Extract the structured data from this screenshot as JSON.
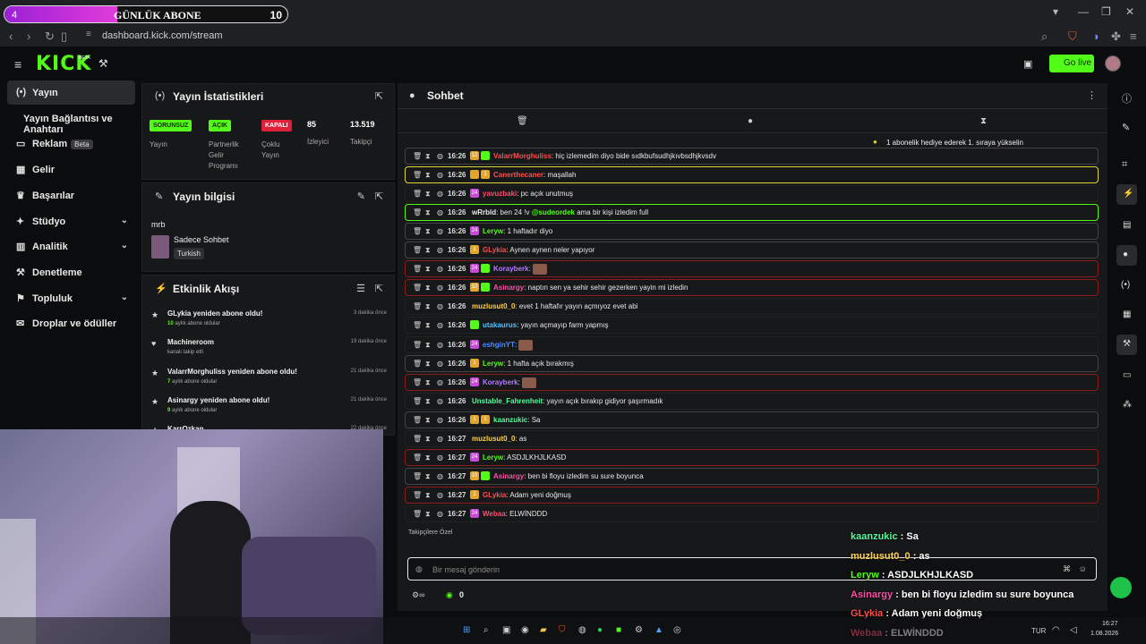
{
  "browser": {
    "url": "dashboard.kick.com/stream",
    "sub_progress_num": "4",
    "sub_label": "GÜNLÜK ABONE",
    "sub_count": "10",
    "sub_progress": 0.4
  },
  "header": {
    "logo": "KICK",
    "beta": "BETA",
    "go_live": "Go live"
  },
  "sidebar": [
    {
      "label": "Yayın",
      "icon": "stream-icon",
      "active": true
    },
    {
      "label": "Yayın Bağlantısı ve Anahtarı"
    },
    {
      "label": "Reklam",
      "badge": "Beta",
      "icon": "tv-icon"
    },
    {
      "label": "Gelir",
      "icon": "chart-icon"
    },
    {
      "label": "Başarılar",
      "icon": "trophy-icon"
    },
    {
      "label": "Stüdyo",
      "icon": "studio-icon",
      "expand": true
    },
    {
      "label": "Analitik",
      "icon": "analytics-icon",
      "expand": true
    },
    {
      "label": "Denetleme",
      "icon": "hammer-icon"
    },
    {
      "label": "Topluluk",
      "icon": "community-icon",
      "expand": true
    },
    {
      "label": "Droplar ve ödüller",
      "icon": "gift-icon"
    }
  ],
  "stats": {
    "title": "Yayın İstatistikleri",
    "items": [
      {
        "badge": "SORUNSUZ",
        "label": "Yayın"
      },
      {
        "badge": "AÇIK",
        "label": "Partnerlik Gelir Programı"
      },
      {
        "badge": "KAPALI",
        "label": "Çoklu Yayın"
      },
      {
        "value": "85",
        "label": "İzleyici"
      },
      {
        "value": "13.519",
        "label": "Takipçi"
      }
    ]
  },
  "info": {
    "title": "Yayın bilgisi",
    "stream_title": "mrb",
    "category": "Sadece Sohbet",
    "language": "Turkish"
  },
  "activity": {
    "title": "Etkinlik Akışı",
    "items": [
      {
        "title": "GLykia yeniden abone oldu!",
        "sub_num": "10",
        "sub": " aylık abone oldular",
        "time": "3 dakika önce"
      },
      {
        "title": "Machineroom",
        "sub": "kanalı takip etti",
        "time": "19 dakika önce"
      },
      {
        "title": "ValarrMorghuliss yeniden abone oldu!",
        "sub_num": "7",
        "sub": " aylık abone oldular",
        "time": "21 dakika önce"
      },
      {
        "title": "Asinargy yeniden abone oldu!",
        "sub_num": "9",
        "sub": " aylık abone oldular",
        "time": "21 dakika önce"
      },
      {
        "title": "KarrOzkan",
        "sub": "",
        "time": "22 dakika önce"
      }
    ]
  },
  "chat": {
    "title": "Sohbet",
    "pinned": "1 abonelik hediye ederek 1. sıraya yükselin",
    "followers_only": "Takipçilere Özel",
    "placeholder": "Bir mesaj gönderin",
    "points": "0",
    "messages": [
      {
        "time": "16:26",
        "badges": [
          "12",
          "sub"
        ],
        "user": "ValarrMorghuliss",
        "color": "#ff4d4d",
        "text": ": hiç izlemedim diyo bide sıdkbufsudhjkıvbsdhjkvsdv",
        "border": "#444"
      },
      {
        "time": "16:26",
        "badges": [
          "crown",
          "1"
        ],
        "user": "Canerthecaner",
        "color": "#ff4d4d",
        "text": ": maşallah",
        "border": "#e2d53a"
      },
      {
        "time": "16:26",
        "badges": [
          "24"
        ],
        "user": "yavuzbaki",
        "color": "#ff4d6d",
        "text": ": pc açık unutmuş",
        "border": "#222"
      },
      {
        "time": "16:26",
        "badges": [],
        "user": "wRrbld",
        "color": "#e8e8e8",
        "text": ": ben 24 !v ",
        "mention": "@sudeordek",
        "after": " ama bir kişi izledim full",
        "border": "#53fc18"
      },
      {
        "time": "16:26",
        "badges": [
          "24"
        ],
        "user": "Leryw",
        "color": "#53fc18",
        "text": ": 1 haftadır diyo",
        "border": "#444"
      },
      {
        "time": "16:26",
        "badges": [
          "1"
        ],
        "user": "GLykia",
        "color": "#ff4d4d",
        "text": ": Aynen aynen neler yapıyor",
        "border": "#444"
      },
      {
        "time": "16:26",
        "badges": [
          "24",
          "sub"
        ],
        "user": "Korayberk",
        "color": "#b07aff",
        "text": ":",
        "border": "#8b1a1a"
      },
      {
        "time": "16:26",
        "badges": [
          "10",
          "sub"
        ],
        "user": "Asinargy",
        "color": "#ff4da6",
        "text": ": naptın sen ya sehir sehir gezerken yayin mi izledin",
        "border": "#8b1a1a"
      },
      {
        "time": "16:26",
        "badges": [],
        "user": "muzlusut0_0",
        "color": "#ffd04d",
        "text": ": evet 1 haftafır yayın açmıyoz evet abi",
        "border": "#222"
      },
      {
        "time": "16:26",
        "badges": [
          "sub"
        ],
        "user": "utakaurus",
        "color": "#4dc3ff",
        "text": ": yayın açmayıp farm yapmış",
        "border": "#222"
      },
      {
        "time": "16:26",
        "badges": [
          "24"
        ],
        "user": "eshginYT",
        "color": "#4d8bff",
        "text": ":",
        "border": "#222"
      },
      {
        "time": "16:26",
        "badges": [
          "1"
        ],
        "user": "Leryw",
        "color": "#53fc18",
        "text": ": 1 hafta açık bırakmış",
        "border": "#444"
      },
      {
        "time": "16:26",
        "badges": [
          "24"
        ],
        "user": "Korayberk",
        "color": "#b07aff",
        "text": ":",
        "border": "#8b1a1a"
      },
      {
        "time": "16:26",
        "badges": [],
        "user": "Unstable_Fahrenheit",
        "color": "#53fc9a",
        "text": ": yayın açık bırakıp gidiyor şaşırmadık",
        "border": "#222"
      },
      {
        "time": "16:26",
        "badges": [
          "1",
          "1"
        ],
        "user": "kaanzukic",
        "color": "#53fc9a",
        "text": ": Sa",
        "border": "#444"
      },
      {
        "time": "16:27",
        "badges": [],
        "user": "muzlusut0_0",
        "color": "#ffd04d",
        "text": ": as",
        "border": "#222"
      },
      {
        "time": "16:27",
        "badges": [
          "24"
        ],
        "user": "Leryw",
        "color": "#53fc18",
        "text": ": ASDJLKHJLKASD",
        "border": "#8b1a1a"
      },
      {
        "time": "16:27",
        "badges": [
          "10",
          "sub"
        ],
        "user": "Asinargy",
        "color": "#ff4da6",
        "text": ": ben bi floyu izledim su sure boyunca",
        "border": "#444"
      },
      {
        "time": "16:27",
        "badges": [
          "1"
        ],
        "user": "GLykia",
        "color": "#ff4d4d",
        "text": ": Adam yeni doğmuş",
        "border": "#8b1a1a"
      },
      {
        "time": "16:27",
        "badges": [
          "24"
        ],
        "user": "Webaa",
        "color": "#ff4d6d",
        "text": ": ELWİNDDD",
        "border": "#222"
      }
    ]
  },
  "overlay": [
    {
      "user": "kaanzukic",
      "text": " : Sa",
      "color": "#53fc9a"
    },
    {
      "user": "muzlusut0_0",
      "text": " : as",
      "color": "#ffd04d"
    },
    {
      "user": "Leryw",
      "text": " : ASDJLKHJLKASD",
      "color": "#53fc18"
    },
    {
      "user": "Asinargy",
      "text": " : ben bi floyu izledim su sure boyunca",
      "color": "#ff4da6"
    },
    {
      "user": "GLykia",
      "text": " : Adam yeni doğmuş",
      "color": "#ff4d4d"
    },
    {
      "user": "Webaa",
      "text": " : ELWİNDDD",
      "color": "#ff4d6d"
    }
  ],
  "taskbar": {
    "lang": "TUR",
    "time": "16:27",
    "date": "1.08.2026"
  }
}
